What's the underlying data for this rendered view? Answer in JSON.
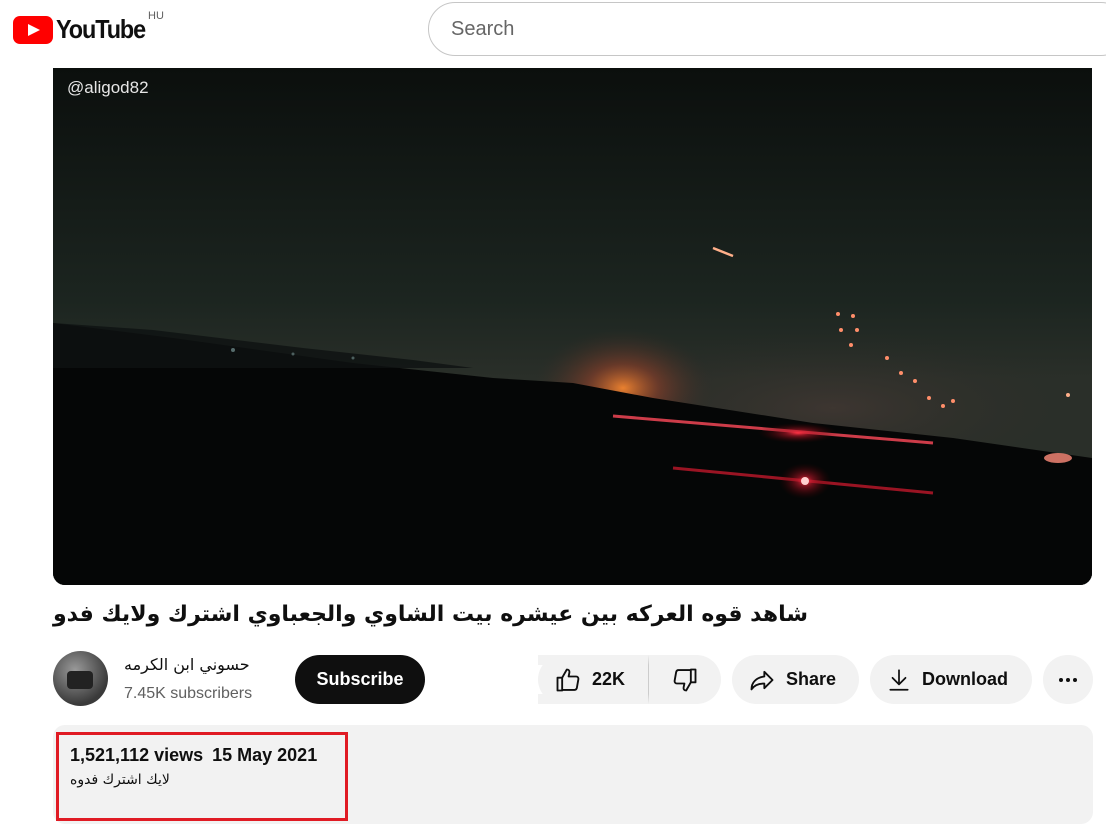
{
  "header": {
    "logo_text": "YouTube",
    "region": "HU",
    "search_placeholder": "Search"
  },
  "video": {
    "watermark": "@aligod82",
    "title": "شاهد قوه العركه بين عيشره بيت الشاوي والجعباوي اشترك ولايك فدو"
  },
  "channel": {
    "name": "حسوني ابن الكرمه",
    "subscribers": "7.45K subscribers",
    "subscribe_label": "Subscribe"
  },
  "actions": {
    "likes": "22K",
    "share_label": "Share",
    "download_label": "Download"
  },
  "description": {
    "views": "1,521,112 views",
    "date": "15 May 2021",
    "text": "لايك اشترك فدوه"
  },
  "icons": {
    "like": "thumbs-up-icon",
    "dislike": "thumbs-down-icon",
    "share": "share-arrow-icon",
    "download": "download-icon",
    "more": "more-horizontal-icon"
  },
  "colors": {
    "brand_red": "#ff0000",
    "highlight_box": "#e01b24",
    "pill_bg": "#f2f2f2"
  }
}
